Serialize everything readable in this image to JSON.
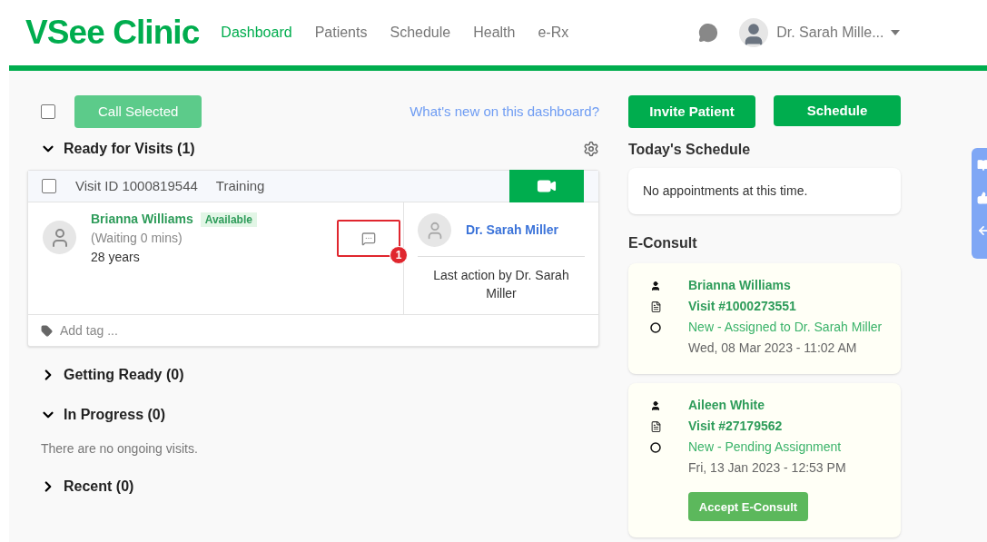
{
  "header": {
    "logo": "VSee Clinic",
    "nav": [
      {
        "label": "Dashboard",
        "selected": true
      },
      {
        "label": "Patients",
        "selected": false
      },
      {
        "label": "Schedule",
        "selected": false
      },
      {
        "label": "Health",
        "selected": false
      },
      {
        "label": "e-Rx",
        "selected": false
      }
    ],
    "user": "Dr. Sarah Mille..."
  },
  "toolbar": {
    "select_all_checked": false,
    "call_button": "Call Selected",
    "call_disabled": true,
    "help_link": "What's new on this dashboard?"
  },
  "sections": [
    {
      "title": "Ready for Visits (1)",
      "expanded": true,
      "visits": [
        {
          "checked": false,
          "visit_id": "Visit ID 1000819544",
          "type": "Training",
          "patient": "Brianna Williams",
          "status": "Available",
          "waiting": "(Waiting 0 mins)",
          "age": "28 years",
          "annotation": "1",
          "provider": "Dr. Sarah Miller",
          "last_action": "Last action by Dr. Sarah Miller",
          "tag_placeholder": "Add tag ..."
        }
      ]
    },
    {
      "title": "Getting Ready (0)",
      "expanded": false
    },
    {
      "title": "In Progress (0)",
      "expanded": true,
      "empty_text": "There are no ongoing visits."
    },
    {
      "title": "Recent (0)",
      "expanded": false
    }
  ],
  "actions": [
    "Invite Patient",
    "Schedule"
  ],
  "schedule": {
    "title": "Today's Schedule",
    "empty_text": "No appointments at this time."
  },
  "econsult": {
    "title": "E-Consult",
    "items": [
      {
        "patient": "Brianna Williams",
        "visit": "Visit #1000273551",
        "status": "New - Assigned to Dr. Sarah Miller",
        "date": "Wed, 08 Mar 2023 - 11:02 AM"
      },
      {
        "patient": "Aileen White",
        "visit": "Visit #27179562",
        "status": "New - Pending Assignment",
        "date": "Fri, 13 Jan 2023 - 12:53 PM",
        "action": "Accept E-Consult"
      }
    ]
  }
}
